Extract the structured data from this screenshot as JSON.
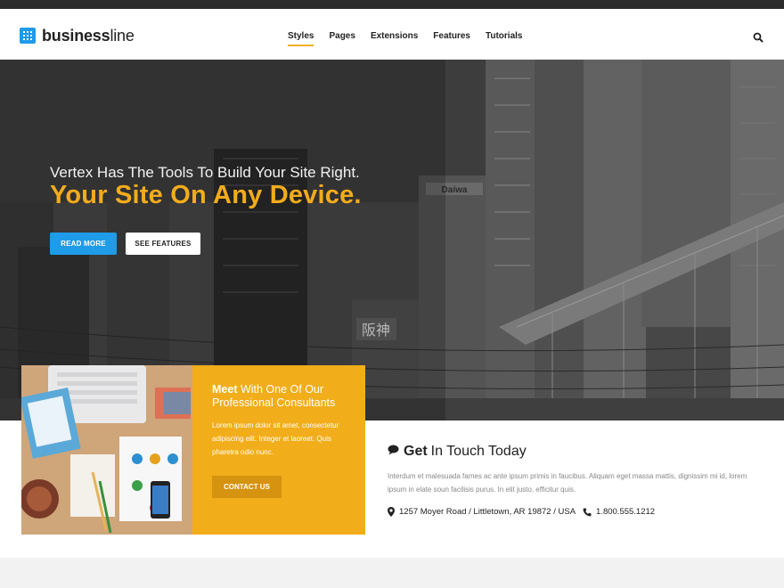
{
  "brand": {
    "bold": "business",
    "light": "line"
  },
  "nav": {
    "items": [
      {
        "label": "Styles",
        "active": true
      },
      {
        "label": "Pages",
        "active": false
      },
      {
        "label": "Extensions",
        "active": false
      },
      {
        "label": "Features",
        "active": false
      },
      {
        "label": "Tutorials",
        "active": false
      }
    ],
    "search_icon": "search-icon"
  },
  "hero": {
    "subtitle": "Vertex Has The Tools To Build Your Site Right.",
    "title": "Your Site On Any Device.",
    "read_more": "READ MORE",
    "see_features": "SEE FEATURES",
    "sign_daiwa": "Daiwa",
    "sign_kanji": "阪神"
  },
  "consultant": {
    "title_bold": "Meet",
    "title_rest": " With One Of Our Professional Consultants",
    "text": "Lorem ipsum dolor sit amet, consectetur adipiscing elit. Integer et laoreet. Quis pharetra odio nunc.",
    "button": "CONTACT US"
  },
  "contact": {
    "title_bold": "Get",
    "title_rest": "In Touch Today",
    "text": "Interdum et malesuada fames ac ante ipsum primis in faucibus. Aliquam eget massa mattis, dignissim mi id, lorem ipsum in elate soun facilisis purus. In elit justo, efficitur quis.",
    "address": "1257 Moyer Road / Littletown, AR 19872 / USA",
    "phone": "1.800.555.1212"
  },
  "colors": {
    "accent": "#f2ad1a",
    "primary": "#1e9be9",
    "dark": "#2b2b2b"
  }
}
